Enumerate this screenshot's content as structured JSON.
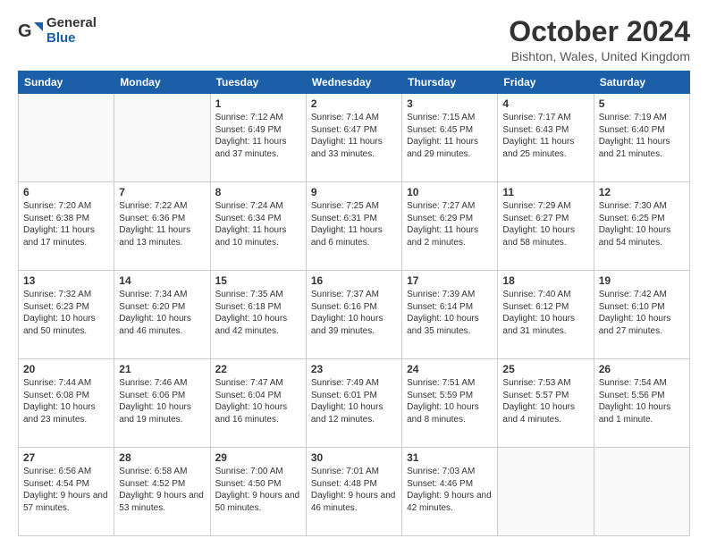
{
  "header": {
    "logo_general": "General",
    "logo_blue": "Blue",
    "title": "October 2024",
    "location": "Bishton, Wales, United Kingdom"
  },
  "days_of_week": [
    "Sunday",
    "Monday",
    "Tuesday",
    "Wednesday",
    "Thursday",
    "Friday",
    "Saturday"
  ],
  "weeks": [
    [
      {
        "day": "",
        "info": ""
      },
      {
        "day": "",
        "info": ""
      },
      {
        "day": "1",
        "info": "Sunrise: 7:12 AM\nSunset: 6:49 PM\nDaylight: 11 hours and 37 minutes."
      },
      {
        "day": "2",
        "info": "Sunrise: 7:14 AM\nSunset: 6:47 PM\nDaylight: 11 hours and 33 minutes."
      },
      {
        "day": "3",
        "info": "Sunrise: 7:15 AM\nSunset: 6:45 PM\nDaylight: 11 hours and 29 minutes."
      },
      {
        "day": "4",
        "info": "Sunrise: 7:17 AM\nSunset: 6:43 PM\nDaylight: 11 hours and 25 minutes."
      },
      {
        "day": "5",
        "info": "Sunrise: 7:19 AM\nSunset: 6:40 PM\nDaylight: 11 hours and 21 minutes."
      }
    ],
    [
      {
        "day": "6",
        "info": "Sunrise: 7:20 AM\nSunset: 6:38 PM\nDaylight: 11 hours and 17 minutes."
      },
      {
        "day": "7",
        "info": "Sunrise: 7:22 AM\nSunset: 6:36 PM\nDaylight: 11 hours and 13 minutes."
      },
      {
        "day": "8",
        "info": "Sunrise: 7:24 AM\nSunset: 6:34 PM\nDaylight: 11 hours and 10 minutes."
      },
      {
        "day": "9",
        "info": "Sunrise: 7:25 AM\nSunset: 6:31 PM\nDaylight: 11 hours and 6 minutes."
      },
      {
        "day": "10",
        "info": "Sunrise: 7:27 AM\nSunset: 6:29 PM\nDaylight: 11 hours and 2 minutes."
      },
      {
        "day": "11",
        "info": "Sunrise: 7:29 AM\nSunset: 6:27 PM\nDaylight: 10 hours and 58 minutes."
      },
      {
        "day": "12",
        "info": "Sunrise: 7:30 AM\nSunset: 6:25 PM\nDaylight: 10 hours and 54 minutes."
      }
    ],
    [
      {
        "day": "13",
        "info": "Sunrise: 7:32 AM\nSunset: 6:23 PM\nDaylight: 10 hours and 50 minutes."
      },
      {
        "day": "14",
        "info": "Sunrise: 7:34 AM\nSunset: 6:20 PM\nDaylight: 10 hours and 46 minutes."
      },
      {
        "day": "15",
        "info": "Sunrise: 7:35 AM\nSunset: 6:18 PM\nDaylight: 10 hours and 42 minutes."
      },
      {
        "day": "16",
        "info": "Sunrise: 7:37 AM\nSunset: 6:16 PM\nDaylight: 10 hours and 39 minutes."
      },
      {
        "day": "17",
        "info": "Sunrise: 7:39 AM\nSunset: 6:14 PM\nDaylight: 10 hours and 35 minutes."
      },
      {
        "day": "18",
        "info": "Sunrise: 7:40 AM\nSunset: 6:12 PM\nDaylight: 10 hours and 31 minutes."
      },
      {
        "day": "19",
        "info": "Sunrise: 7:42 AM\nSunset: 6:10 PM\nDaylight: 10 hours and 27 minutes."
      }
    ],
    [
      {
        "day": "20",
        "info": "Sunrise: 7:44 AM\nSunset: 6:08 PM\nDaylight: 10 hours and 23 minutes."
      },
      {
        "day": "21",
        "info": "Sunrise: 7:46 AM\nSunset: 6:06 PM\nDaylight: 10 hours and 19 minutes."
      },
      {
        "day": "22",
        "info": "Sunrise: 7:47 AM\nSunset: 6:04 PM\nDaylight: 10 hours and 16 minutes."
      },
      {
        "day": "23",
        "info": "Sunrise: 7:49 AM\nSunset: 6:01 PM\nDaylight: 10 hours and 12 minutes."
      },
      {
        "day": "24",
        "info": "Sunrise: 7:51 AM\nSunset: 5:59 PM\nDaylight: 10 hours and 8 minutes."
      },
      {
        "day": "25",
        "info": "Sunrise: 7:53 AM\nSunset: 5:57 PM\nDaylight: 10 hours and 4 minutes."
      },
      {
        "day": "26",
        "info": "Sunrise: 7:54 AM\nSunset: 5:56 PM\nDaylight: 10 hours and 1 minute."
      }
    ],
    [
      {
        "day": "27",
        "info": "Sunrise: 6:56 AM\nSunset: 4:54 PM\nDaylight: 9 hours and 57 minutes."
      },
      {
        "day": "28",
        "info": "Sunrise: 6:58 AM\nSunset: 4:52 PM\nDaylight: 9 hours and 53 minutes."
      },
      {
        "day": "29",
        "info": "Sunrise: 7:00 AM\nSunset: 4:50 PM\nDaylight: 9 hours and 50 minutes."
      },
      {
        "day": "30",
        "info": "Sunrise: 7:01 AM\nSunset: 4:48 PM\nDaylight: 9 hours and 46 minutes."
      },
      {
        "day": "31",
        "info": "Sunrise: 7:03 AM\nSunset: 4:46 PM\nDaylight: 9 hours and 42 minutes."
      },
      {
        "day": "",
        "info": ""
      },
      {
        "day": "",
        "info": ""
      }
    ]
  ]
}
